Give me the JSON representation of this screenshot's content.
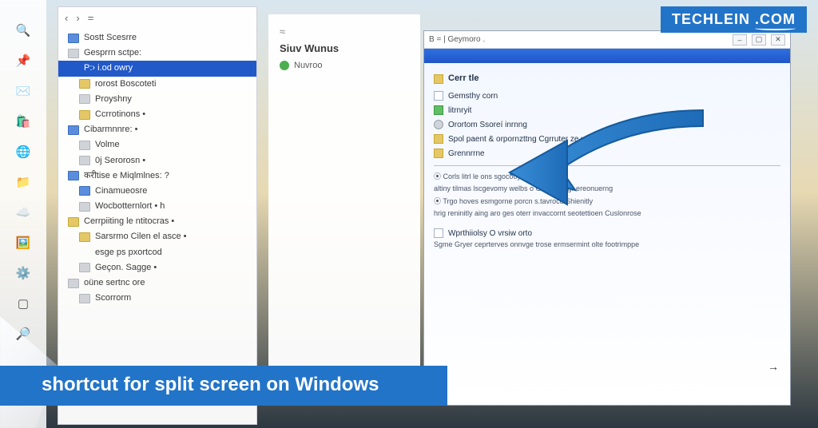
{
  "watermark": {
    "part1": "TECHLEIN",
    "part2": ".COM"
  },
  "caption": "shortcut for split screen on Windows",
  "taskbar_icons": [
    "search",
    "pin",
    "mail",
    "store",
    "edge",
    "explorer",
    "cloud",
    "photos",
    "settings",
    "terminal",
    "search2"
  ],
  "left_panel": {
    "toolbar_glyphs": [
      "‹",
      "›",
      "="
    ],
    "items": [
      {
        "icon": "blue",
        "label": "Sostt Scesrre"
      },
      {
        "icon": "grey",
        "label": "Gesprrn sctpe:"
      },
      {
        "icon": "",
        "label": "P:› i.od owry",
        "selected": true
      },
      {
        "icon": "folder",
        "label": "rorost Boscoteti",
        "child": true
      },
      {
        "icon": "grey",
        "label": "Proyshny",
        "child": true
      },
      {
        "icon": "folder",
        "label": "Ccrrotinons  •",
        "child": true
      },
      {
        "icon": "blue",
        "label": "Cibarmnnre: •"
      },
      {
        "icon": "grey",
        "label": "Volme",
        "child": true
      },
      {
        "icon": "grey",
        "label": "0j Serorosn •",
        "child": true
      },
      {
        "icon": "blue",
        "label": "करीtise e Miqlmlnes: ?"
      },
      {
        "icon": "blue",
        "label": "Cinamueosre",
        "child": true
      },
      {
        "icon": "grey",
        "label": "Wocbotternlort  •     h",
        "child": true
      },
      {
        "icon": "folder",
        "label": "Cerrpiiting le ntitocras •"
      },
      {
        "icon": "folder",
        "label": "Sarsrmo Cilen el asce  •",
        "child": true
      },
      {
        "icon": "",
        "label": "esge ps pxortcod",
        "child": true
      },
      {
        "icon": "grey",
        "label": "Geçon. Sagge •",
        "child": true
      },
      {
        "icon": "grey",
        "label": "oüne sertnc ore"
      },
      {
        "icon": "grey",
        "label": "Scorrorm",
        "child": true
      }
    ]
  },
  "mid_panel": {
    "title": "Siuv Wunus",
    "sub": "Nuvroo"
  },
  "right_window": {
    "title_left": "B   =   | Geymoro .",
    "title_right": "",
    "section1_title": "Cerr tle",
    "section1_items": [
      {
        "icon": "box",
        "label": "Gemsthy corn"
      },
      {
        "icon": "green",
        "label": "litrnryit"
      },
      {
        "icon": "gear",
        "label": "Orortom Ssoreí inrnng"
      },
      {
        "icon": "folder",
        "label": "Spol paent & orpornzttng Cgrruter ze vecs"
      },
      {
        "icon": "folder",
        "label": "Grennrrne"
      }
    ],
    "section2": [
      "Corls litrl le ons sgocooyors of espeç |",
      "altiny tilmas lscgevomy welbs o Gäeruorl tgr ereonuerng",
      "Trgo hoves esmgorne porcn s.tavrocd Shienitly",
      "hrig reninitly aing aro ges oterr invaccornt seotettioen Cuslonrose"
    ],
    "section3_head": "Wprthiiolsy   O vrsiw orto",
    "section3_body": "Sgme Gryer ceprterves onnvge trose ermsermint olte footrimppe"
  }
}
